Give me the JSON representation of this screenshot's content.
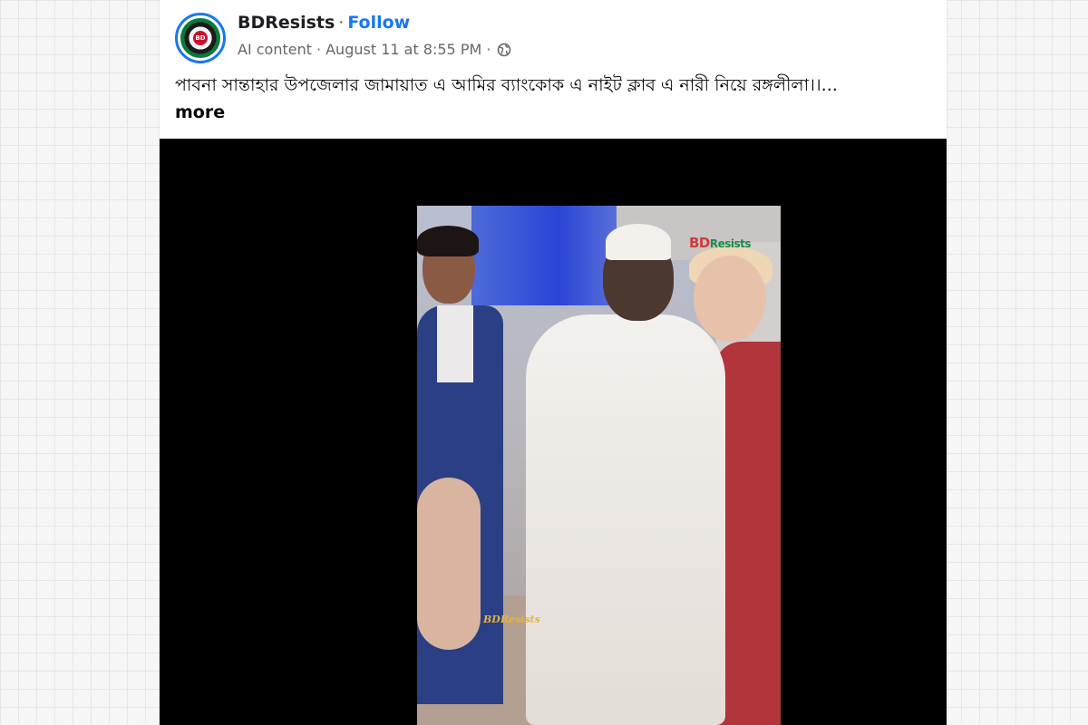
{
  "post": {
    "page_name": "BDResists",
    "separator": "·",
    "follow_label": "Follow",
    "meta_label": "AI content",
    "meta_separator": "·",
    "timestamp": "August 11 at 8:55 PM",
    "meta_separator_2": "·",
    "audience_icon": "globe-icon",
    "caption": "পাবনা সান্তাহার উপজেলার জামায়াত এ আমির  ব্যাংকোক এ নাইট ক্লাব এ নারী নিয়ে রঙ্গলীলা।।...",
    "more_label": "more",
    "avatar_text": "BD"
  },
  "video": {
    "watermark_top_initial": "BD",
    "watermark_top_rest": "Resists",
    "watermark_bottom": "BDResists"
  },
  "colors": {
    "accent": "#1877f2",
    "secondary_text": "#65676b",
    "video_background": "#000000"
  }
}
